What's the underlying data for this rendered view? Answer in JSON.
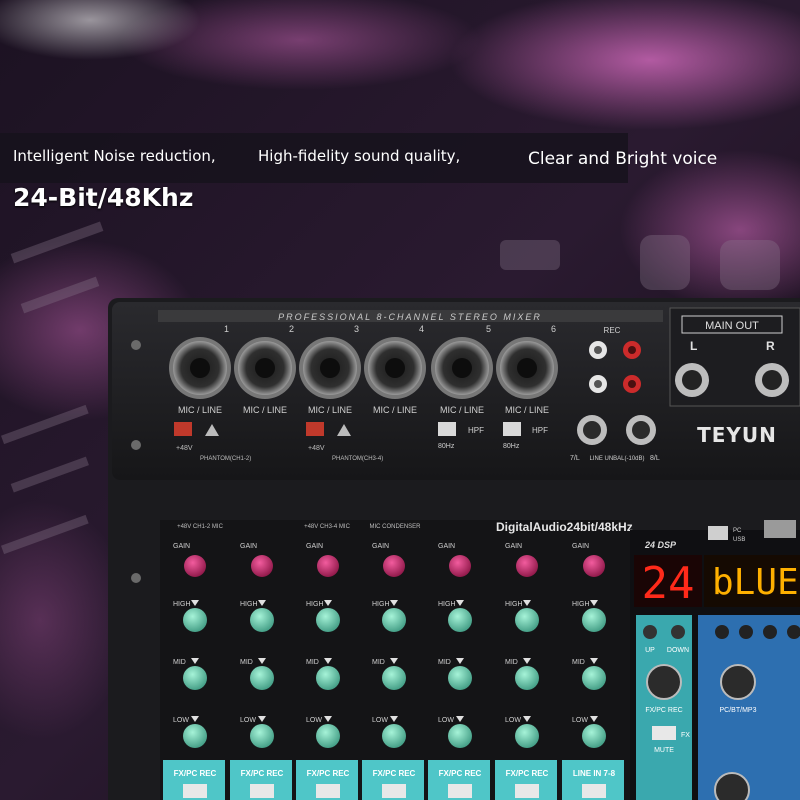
{
  "banner": {
    "taglines": [
      "Intelligent Noise reduction,",
      "High-fidelity sound quality,",
      "Clear and Bright voice"
    ],
    "spec": "24-Bit/48Khz"
  },
  "mixer": {
    "top_label": "PROFESSIONAL 8-CHANNEL STEREO MIXER",
    "main_out": "MAIN OUT",
    "out_left": "L",
    "out_right": "R",
    "rec": "REC",
    "brand": "TEYUN",
    "channels": [
      "1",
      "2",
      "3",
      "4",
      "5",
      "6"
    ],
    "mic_line": "MIC / LINE",
    "phantom_v": "+48V",
    "phantom_1": "PHANTOM(CH1-2)",
    "phantom_2": "PHANTOM(CH3-4)",
    "hpf": "HPF",
    "hz": "80Hz",
    "line_input": "LINE UNBAL(-10dB)",
    "jack_7": "7/L",
    "jack_8": "8/L",
    "dsp_title": "DigitalAudio24bit/48kHz",
    "dsp_badge": "24 DSP",
    "pc": "PC",
    "usb": "USB",
    "led_number": "24",
    "led_text": "bLUE",
    "up": "UP",
    "down": "DOWN",
    "fx_pc_rec_panel": "FX/PC REC",
    "mute": "MUTE",
    "fx": "FX",
    "pc_bt_mp3": "PC/BT/MP3",
    "top_labels": [
      "+48V CH1-2 MIC",
      "+48V CH3-4 MIC",
      "MIC CONDENSER"
    ],
    "strip_labels": [
      "GAIN",
      "HIGH",
      "MID",
      "LOW"
    ],
    "bottom_labels": [
      "FX/PC REC",
      "FX/PC REC",
      "FX/PC REC",
      "FX/PC REC",
      "FX/PC REC",
      "FX/PC REC",
      "LINE IN 7-8"
    ]
  },
  "colors": {
    "gain_knob": "#d8307a",
    "eq_knob": "#7fe0c0",
    "led": "#ff2a1a",
    "teal_strip": "#4fc6c8",
    "blue_panel": "#2d6fb0"
  }
}
